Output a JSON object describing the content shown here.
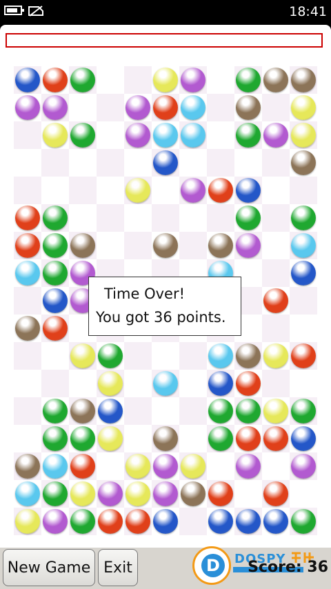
{
  "status_bar": {
    "time": "18:41",
    "icons": [
      "battery-icon",
      "no-sim-icon"
    ]
  },
  "timer_bar": {
    "remaining_fraction": 0
  },
  "colors": {
    "blue": "#2457c8",
    "red": "#e0401a",
    "green": "#1fa830",
    "yellow": "#e6e85a",
    "purple": "#b25ad0",
    "cyan": "#5ac8ee",
    "brown": "#8c7458"
  },
  "board": {
    "columns": 11,
    "rows": [
      [
        "blue",
        "red",
        "green",
        "",
        "",
        "yellow",
        "purple",
        "",
        "green",
        "brown",
        "brown"
      ],
      [
        "purple",
        "purple",
        "",
        "",
        "purple",
        "red",
        "cyan",
        "",
        "brown",
        "",
        "yellow"
      ],
      [
        "",
        "yellow",
        "green",
        "",
        "purple",
        "cyan",
        "cyan",
        "",
        "green",
        "purple",
        "yellow"
      ],
      [
        "",
        "",
        "",
        "",
        "",
        "blue",
        "",
        "",
        "",
        "",
        "brown"
      ],
      [
        "",
        "",
        "",
        "",
        "yellow",
        "",
        "purple",
        "red",
        "blue",
        "",
        ""
      ],
      [
        "red",
        "green",
        "",
        "",
        "",
        "",
        "",
        "",
        "green",
        "",
        "green"
      ],
      [
        "red",
        "green",
        "brown",
        "",
        "",
        "brown",
        "",
        "brown",
        "purple",
        "",
        "cyan"
      ],
      [
        "cyan",
        "green",
        "purple",
        "",
        "",
        "",
        "",
        "cyan",
        "",
        "",
        "blue"
      ],
      [
        "",
        "blue",
        "purple",
        "",
        "",
        "",
        "",
        "",
        "",
        "red",
        ""
      ],
      [
        "brown",
        "red",
        "",
        "",
        "",
        "",
        "",
        "",
        "",
        "",
        ""
      ],
      [
        "",
        "",
        "yellow",
        "green",
        "",
        "",
        "",
        "cyan",
        "brown",
        "yellow",
        "red"
      ],
      [
        "",
        "",
        "",
        "yellow",
        "",
        "cyan",
        "",
        "blue",
        "red",
        "",
        ""
      ],
      [
        "",
        "green",
        "brown",
        "blue",
        "",
        "",
        "",
        "green",
        "green",
        "yellow",
        "green"
      ],
      [
        "",
        "green",
        "green",
        "yellow",
        "",
        "brown",
        "",
        "green",
        "red",
        "red",
        "blue"
      ],
      [
        "brown",
        "cyan",
        "red",
        "",
        "yellow",
        "purple",
        "yellow",
        "",
        "purple",
        "",
        "purple"
      ],
      [
        "cyan",
        "green",
        "yellow",
        "purple",
        "yellow",
        "purple",
        "brown",
        "red",
        "",
        "red",
        ""
      ],
      [
        "yellow",
        "purple",
        "green",
        "red",
        "red",
        "blue",
        "",
        "blue",
        "blue",
        "blue",
        "green"
      ]
    ]
  },
  "dialog": {
    "line1": "Time Over!",
    "line2": "You got 36 points."
  },
  "buttons": {
    "new_game": "New Game",
    "exit": "Exit"
  },
  "score": "Score: 36",
  "watermark": {
    "text": "DOSPY"
  }
}
